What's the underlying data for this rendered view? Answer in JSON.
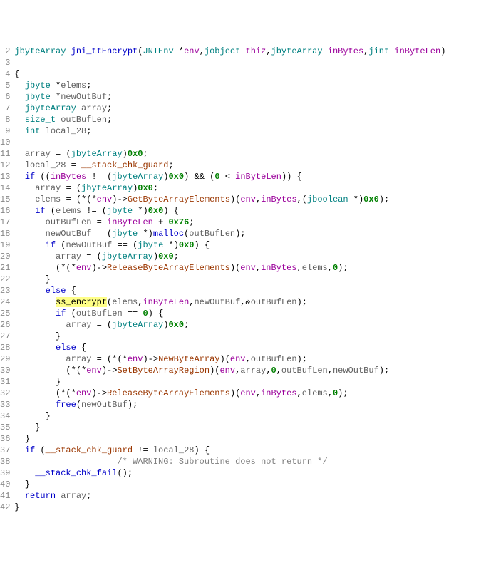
{
  "colors": {
    "keyword": "#0000c8",
    "type": "#008080",
    "param": "#9b009b",
    "variable": "#606060",
    "number": "#008000",
    "field": "#9a3600",
    "highlight_bg": "#ffff88",
    "comment": "#808080"
  },
  "gutter": {
    "start": 2,
    "end": 42
  },
  "code": {
    "signature": {
      "return_type": "jbyteArray",
      "name": "jni_ttEncrypt",
      "params": [
        {
          "type": "JNIEnv",
          "deref": "*",
          "name": "env"
        },
        {
          "type": "jobject",
          "name": "thiz"
        },
        {
          "type": "jbyteArray",
          "name": "inBytes"
        },
        {
          "type": "jint",
          "name": "inByteLen"
        }
      ]
    },
    "decls": [
      {
        "type": "jbyte",
        "ptr": "*",
        "name": "elems"
      },
      {
        "type": "jbyte",
        "ptr": "*",
        "name": "newOutBuf"
      },
      {
        "type": "jbyteArray",
        "name": "array"
      },
      {
        "type": "size_t",
        "name": "outBufLen"
      },
      {
        "type": "int",
        "name": "local_28"
      }
    ],
    "tokens": {
      "if": "if",
      "else": "else",
      "return": "return",
      "array": "array",
      "local_28": "local_28",
      "stack_chk_guard": "__stack_chk_guard",
      "stack_chk_fail": "__stack_chk_fail",
      "inBytes": "inBytes",
      "inByteLen": "inByteLen",
      "elems": "elems",
      "env": "env",
      "newOutBuf": "newOutBuf",
      "outBufLen": "outBufLen",
      "jbyteArray": "jbyteArray",
      "jbyte": "jbyte",
      "jboolean": "jboolean",
      "malloc": "malloc",
      "free": "free",
      "ss_encrypt": "ss_encrypt",
      "GetByteArrayElements": "GetByteArrayElements",
      "ReleaseByteArrayElements": "ReleaseByteArrayElements",
      "NewByteArray": "NewByteArray",
      "SetByteArrayRegion": "SetByteArrayRegion",
      "hex0x0": "0x0",
      "hex0x76": "0x76",
      "zero": "0",
      "warning_comment": "/* WARNING: Subroutine does not return */"
    }
  }
}
